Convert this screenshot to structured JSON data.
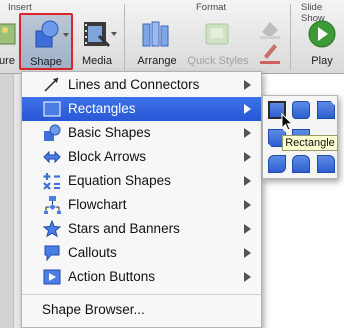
{
  "ribbon": {
    "groups": [
      {
        "label": "Insert"
      },
      {
        "label": "Format"
      },
      {
        "label": "Slide Show"
      }
    ],
    "buttons": {
      "picture_partial": "ure",
      "shape": "Shape",
      "media": "Media",
      "arrange": "Arrange",
      "quick_styles": "Quick Styles",
      "play": "Play"
    }
  },
  "menu": {
    "items": [
      {
        "label": "Lines and Connectors",
        "icon": "lines-icon",
        "submenu": true
      },
      {
        "label": "Rectangles",
        "icon": "rectangle-icon",
        "submenu": true,
        "active": true
      },
      {
        "label": "Basic Shapes",
        "icon": "basic-shapes-icon",
        "submenu": true
      },
      {
        "label": "Block Arrows",
        "icon": "block-arrow-icon",
        "submenu": true
      },
      {
        "label": "Equation Shapes",
        "icon": "equation-icon",
        "submenu": true
      },
      {
        "label": "Flowchart",
        "icon": "flowchart-icon",
        "submenu": true
      },
      {
        "label": "Stars and Banners",
        "icon": "star-icon",
        "submenu": true
      },
      {
        "label": "Callouts",
        "icon": "callout-icon",
        "submenu": true
      },
      {
        "label": "Action Buttons",
        "icon": "action-button-icon",
        "submenu": true
      }
    ],
    "shape_browser": "Shape Browser..."
  },
  "submenu": {
    "tooltip": "Rectangle",
    "shape_count": 8
  },
  "colors": {
    "highlight": "#2f5fdc",
    "shape_blue": "#3a6ad8",
    "selected_border": "#d9262a",
    "tooltip_bg": "#fffdd2"
  }
}
